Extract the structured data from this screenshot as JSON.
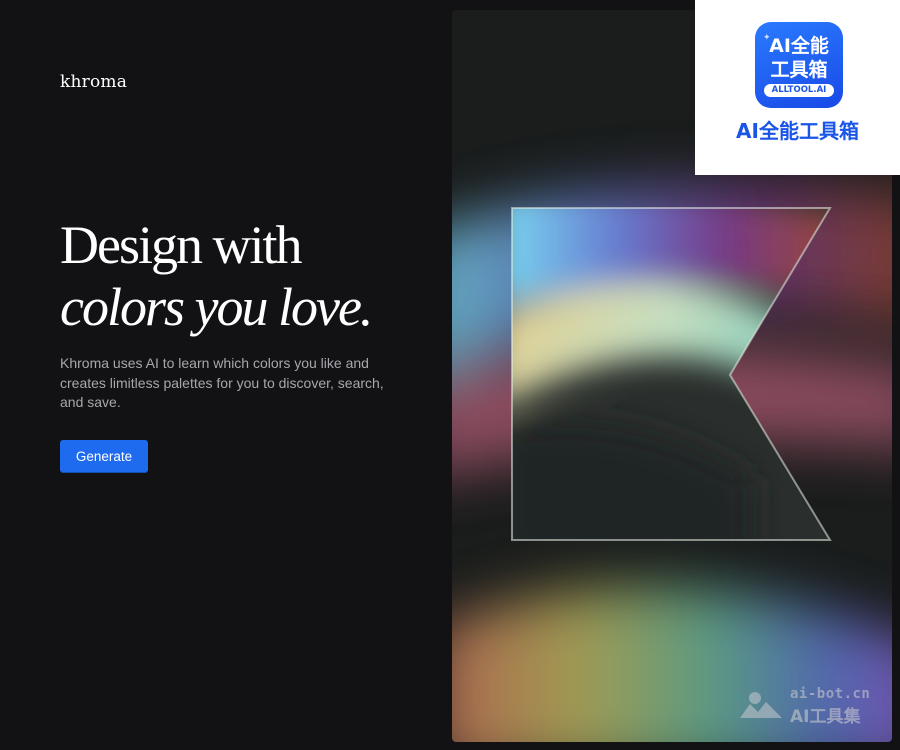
{
  "header": {
    "logo_text": "khroma"
  },
  "hero": {
    "title_line1": "Design with",
    "title_line2": "colors you love.",
    "description": "Khroma uses AI to learn which colors you like and creates limitless palettes for you to discover, search, and save.",
    "cta_label": "Generate"
  },
  "colors": {
    "background": "#121214",
    "button": "#1f6bf0",
    "badge_blue": "#1a55e8"
  },
  "overlay_badge": {
    "icon_line1": "AI全能",
    "icon_line2": "工具箱",
    "icon_tag": "ALLTOOL.AI",
    "caption": "AI全能工具箱"
  },
  "watermark": {
    "url": "ai-bot.cn",
    "name": "AI工具集"
  }
}
